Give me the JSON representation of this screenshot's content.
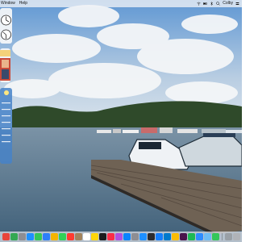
{
  "menubar": {
    "items": [
      {
        "label": "Window"
      },
      {
        "label": "Help"
      }
    ],
    "right": {
      "user": "Colby"
    }
  },
  "widgets": {
    "clock": {
      "label": "clock"
    },
    "photo": {
      "label": "photo"
    },
    "weather": {
      "label": "weather"
    }
  },
  "dock": {
    "apps": [
      {
        "name": "news-icon",
        "color": "#e8443a"
      },
      {
        "name": "maps-icon",
        "color": "#34a853"
      },
      {
        "name": "launchpad-icon",
        "color": "#8e8e93"
      },
      {
        "name": "safari-icon",
        "color": "#1e90ff"
      },
      {
        "name": "messages-icon",
        "color": "#34c759"
      },
      {
        "name": "mail-icon",
        "color": "#2d7ff9"
      },
      {
        "name": "photos-icon",
        "color": "#f4b400"
      },
      {
        "name": "facetime-icon",
        "color": "#30d158"
      },
      {
        "name": "calendar-icon",
        "color": "#ff3b30"
      },
      {
        "name": "contacts-icon",
        "color": "#a2845e"
      },
      {
        "name": "reminders-icon",
        "color": "#ffffff"
      },
      {
        "name": "notes-icon",
        "color": "#ffd60a"
      },
      {
        "name": "tv-icon",
        "color": "#1c1c1e"
      },
      {
        "name": "music-icon",
        "color": "#fa2d48"
      },
      {
        "name": "podcasts-icon",
        "color": "#b150e2"
      },
      {
        "name": "appstore-icon",
        "color": "#0a84ff"
      },
      {
        "name": "settings-icon",
        "color": "#8e8e93"
      },
      {
        "name": "finder-icon",
        "color": "#1e90ff"
      },
      {
        "name": "terminal-icon",
        "color": "#2c2c2e"
      },
      {
        "name": "xcode-icon",
        "color": "#147efb"
      },
      {
        "name": "vscode-icon",
        "color": "#007acc"
      },
      {
        "name": "chrome-icon",
        "color": "#fbbc05"
      },
      {
        "name": "slack-icon",
        "color": "#4a154b"
      },
      {
        "name": "spotify-icon",
        "color": "#1db954"
      },
      {
        "name": "zoom-icon",
        "color": "#2d8cff"
      },
      {
        "name": "preview-icon",
        "color": "#6cbcf5"
      },
      {
        "name": "activity-icon",
        "color": "#34c759"
      },
      {
        "name": "downloads-icon",
        "color": "#9aa0a6"
      },
      {
        "name": "trash-icon",
        "color": "#b0b3b8"
      }
    ]
  },
  "colors": {
    "sky_top": "#6a9fd8",
    "sky_bottom": "#d9e3ee",
    "water": "#5c7a92",
    "trees": "#2f4a2a",
    "dock_bg": "#e1e4eb"
  }
}
